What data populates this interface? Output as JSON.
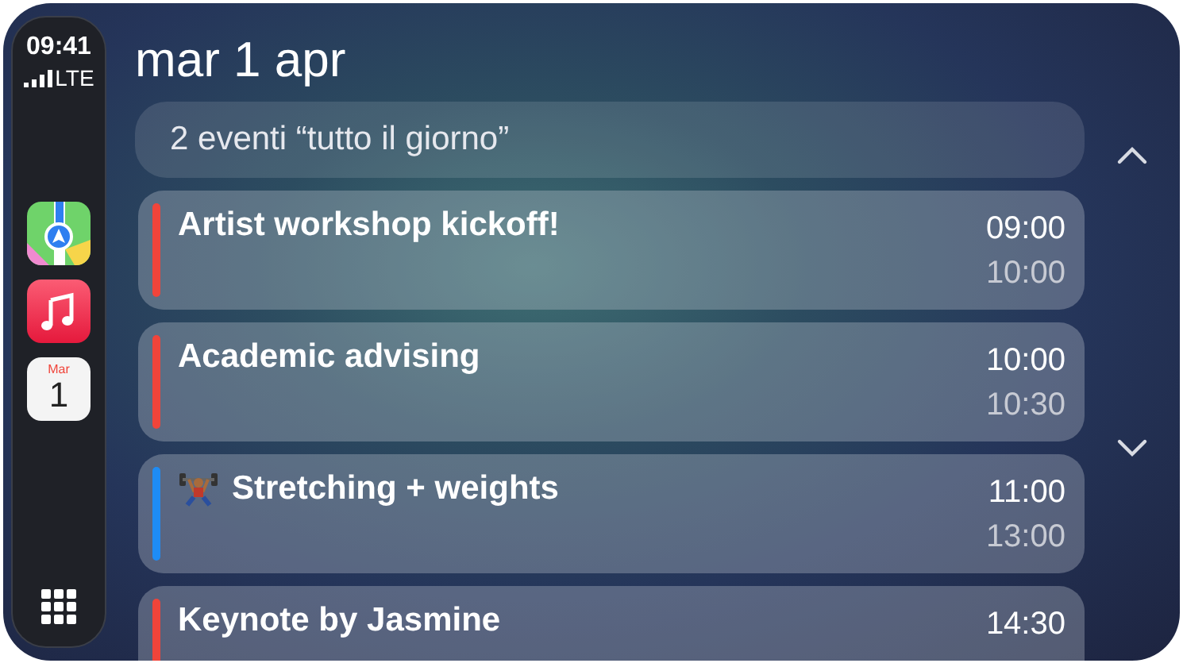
{
  "status": {
    "time": "09:41",
    "network": "LTE"
  },
  "dock": [
    {
      "kind": "maps"
    },
    {
      "kind": "music"
    },
    {
      "kind": "calendar",
      "month": "Mar",
      "day": "1"
    }
  ],
  "header": {
    "title": "mar 1 apr"
  },
  "all_day": {
    "label": "2 eventi “tutto il giorno”"
  },
  "events": [
    {
      "kind": "plain",
      "title": "Artist workshop kickoff!",
      "start": "09:00",
      "end": "10:00",
      "color": "#f0443a"
    },
    {
      "kind": "plain",
      "title": "Academic advising",
      "start": "10:00",
      "end": "10:30",
      "color": "#f0443a"
    },
    {
      "kind": "workout",
      "title": "Stretching + weights",
      "start": "11:00",
      "end": "13:00",
      "color": "#1e8cf5"
    },
    {
      "kind": "plain",
      "title": "Keynote by Jasmine",
      "start": "14:30",
      "color": "#f0443a"
    }
  ]
}
